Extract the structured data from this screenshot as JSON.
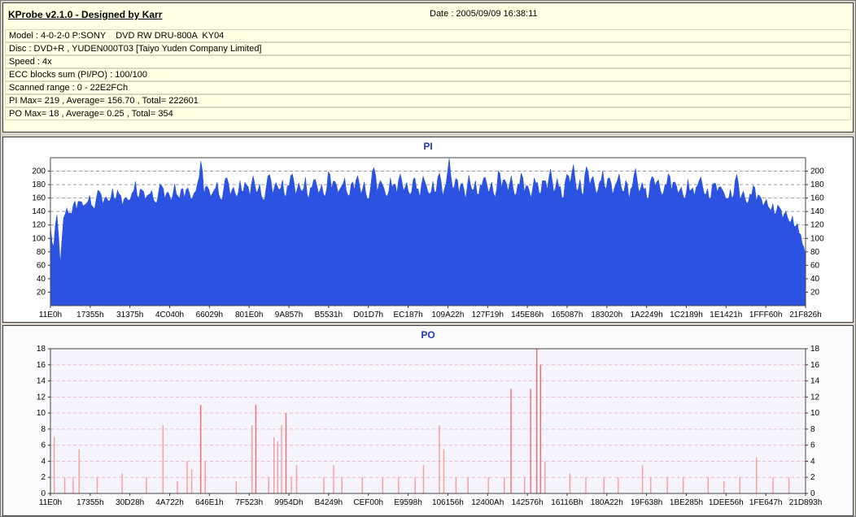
{
  "window": {
    "title": "KProbe v2.1.0 - Designed by Karr",
    "date_label": "Date : 2005/09/09 16:38:11"
  },
  "info": {
    "rows": [
      "Model : 4-0-2-0 P:SONY    DVD RW DRU-800A  KY04",
      "Disc : DVD+R , YUDEN000T03 [Taiyo Yuden Company Limited]",
      "Speed : 4x",
      "ECC blocks sum (PI/PO) : 100/100",
      "Scanned range : 0 - 22E2FCh",
      "PI Max= 219 , Average= 156.70 , Total= 222601",
      "PO Max= 18 , Average= 0.25 , Total= 354"
    ]
  },
  "chart_data": [
    {
      "id": "pi",
      "type": "bar",
      "title": "PI",
      "ylabel": "",
      "xlabel": "",
      "ylim": [
        0,
        220
      ],
      "yticks": [
        20,
        40,
        60,
        80,
        100,
        120,
        140,
        160,
        180,
        200
      ],
      "x_tick_labels": [
        "11E0h",
        "17355h",
        "31375h",
        "4C040h",
        "66029h",
        "801E0h",
        "9A857h",
        "B5531h",
        "D01D7h",
        "EC187h",
        "109A22h",
        "127F19h",
        "145E86h",
        "165087h",
        "183020h",
        "1A2249h",
        "1C2189h",
        "1E1421h",
        "1FFF60h",
        "21F826h"
      ],
      "bar_color": "#2C52E2",
      "grid_color": "#9898B0",
      "plot_bg": "#FFFFFF",
      "stats": {
        "max": 219,
        "average": 156.7,
        "total": 222601
      },
      "values": [
        118,
        88,
        135,
        62,
        130,
        145,
        138,
        150,
        143,
        155,
        148,
        152,
        164,
        147,
        158,
        170,
        151,
        162,
        155,
        174,
        159,
        166,
        149,
        161,
        156,
        168,
        185,
        160,
        172,
        158,
        165,
        171,
        154,
        166,
        178,
        159,
        169,
        156,
        181,
        163,
        173,
        160,
        175,
        158,
        168,
        182,
        215,
        166,
        177,
        162,
        171,
        184,
        159,
        173,
        190,
        164,
        176,
        161,
        186,
        170,
        179,
        163,
        193,
        168,
        181,
        158,
        175,
        195,
        166,
        183,
        172,
        187,
        161,
        178,
        196,
        165,
        182,
        170,
        191,
        159,
        176,
        188,
        167,
        180,
        162,
        199,
        173,
        185,
        168,
        177,
        190,
        164,
        181,
        172,
        193,
        166,
        184,
        158,
        178,
        205,
        169,
        186,
        175,
        162,
        190,
        180,
        167,
        196,
        171,
        183,
        165,
        188,
        174,
        161,
        192,
        178,
        166,
        185,
        170,
        197,
        163,
        181,
        219,
        176,
        189,
        167,
        182,
        158,
        194,
        172,
        186,
        165,
        179,
        191,
        168,
        184,
        161,
        200,
        175,
        187,
        170,
        193,
        164,
        181,
        197,
        169,
        178,
        160,
        190,
        183,
        167,
        186,
        172,
        203,
        168,
        189,
        177,
        161,
        195,
        182,
        210,
        170,
        188,
        164,
        207,
        179,
        192,
        166,
        184,
        201,
        173,
        190,
        165,
        181,
        196,
        170,
        186,
        158,
        177,
        204,
        169,
        183,
        175,
        161,
        192,
        178,
        187,
        164,
        180,
        196,
        171,
        184,
        167,
        176,
        158,
        188,
        172,
        163,
        179,
        191,
        166,
        174,
        160,
        182,
        169,
        177,
        168,
        159,
        173,
        164,
        195,
        157,
        170,
        152,
        166,
        178,
        155,
        163,
        148,
        158,
        144,
        152,
        138,
        146,
        130,
        140,
        125,
        133,
        118,
        108,
        92,
        75
      ]
    },
    {
      "id": "po",
      "type": "bar",
      "title": "PO",
      "ylabel": "",
      "xlabel": "",
      "ylim": [
        0,
        18
      ],
      "yticks": [
        0,
        2,
        4,
        6,
        8,
        10,
        12,
        14,
        16,
        18
      ],
      "x_tick_labels": [
        "11E0h",
        "17355h",
        "30D28h",
        "4A722h",
        "646E1h",
        "7F523h",
        "9954Dh",
        "B4249h",
        "CEF00h",
        "E9598h",
        "106156h",
        "12400Ah",
        "142576h",
        "16116Bh",
        "180A22h",
        "19F638h",
        "1BE285h",
        "1DEE56h",
        "1FE647h",
        "21D893h"
      ],
      "bar_color": "#F49C9C",
      "bar_color_strong": "#EE6A6A",
      "grid_color": "#EBB7C6",
      "plot_bg": "#F5F4FC",
      "stats": {
        "max": 18,
        "average": 0.25,
        "total": 354
      },
      "spikes": [
        {
          "x": 0.005,
          "v": 7
        },
        {
          "x": 0.019,
          "v": 2
        },
        {
          "x": 0.03,
          "v": 2
        },
        {
          "x": 0.038,
          "v": 5.5
        },
        {
          "x": 0.062,
          "v": 2
        },
        {
          "x": 0.095,
          "v": 2.5
        },
        {
          "x": 0.127,
          "v": 2
        },
        {
          "x": 0.149,
          "v": 8.5
        },
        {
          "x": 0.168,
          "v": 1.5
        },
        {
          "x": 0.181,
          "v": 4
        },
        {
          "x": 0.187,
          "v": 3
        },
        {
          "x": 0.199,
          "v": 11
        },
        {
          "x": 0.205,
          "v": 4
        },
        {
          "x": 0.246,
          "v": 1.5
        },
        {
          "x": 0.267,
          "v": 8.5
        },
        {
          "x": 0.272,
          "v": 11
        },
        {
          "x": 0.289,
          "v": 2
        },
        {
          "x": 0.296,
          "v": 7
        },
        {
          "x": 0.301,
          "v": 6.5
        },
        {
          "x": 0.306,
          "v": 8.5
        },
        {
          "x": 0.312,
          "v": 10
        },
        {
          "x": 0.319,
          "v": 2
        },
        {
          "x": 0.326,
          "v": 3.5
        },
        {
          "x": 0.362,
          "v": 2
        },
        {
          "x": 0.375,
          "v": 3.5
        },
        {
          "x": 0.386,
          "v": 2
        },
        {
          "x": 0.413,
          "v": 2
        },
        {
          "x": 0.44,
          "v": 2
        },
        {
          "x": 0.461,
          "v": 2
        },
        {
          "x": 0.483,
          "v": 2
        },
        {
          "x": 0.494,
          "v": 3.5
        },
        {
          "x": 0.515,
          "v": 8.5
        },
        {
          "x": 0.521,
          "v": 5.5
        },
        {
          "x": 0.537,
          "v": 2
        },
        {
          "x": 0.553,
          "v": 2
        },
        {
          "x": 0.58,
          "v": 2
        },
        {
          "x": 0.601,
          "v": 2
        },
        {
          "x": 0.61,
          "v": 13
        },
        {
          "x": 0.628,
          "v": 2
        },
        {
          "x": 0.636,
          "v": 13
        },
        {
          "x": 0.644,
          "v": 18
        },
        {
          "x": 0.649,
          "v": 16
        },
        {
          "x": 0.655,
          "v": 4
        },
        {
          "x": 0.688,
          "v": 2.5
        },
        {
          "x": 0.709,
          "v": 2
        },
        {
          "x": 0.733,
          "v": 2
        },
        {
          "x": 0.752,
          "v": 2
        },
        {
          "x": 0.784,
          "v": 3.5
        },
        {
          "x": 0.795,
          "v": 2
        },
        {
          "x": 0.817,
          "v": 2
        },
        {
          "x": 0.838,
          "v": 2
        },
        {
          "x": 0.871,
          "v": 2
        },
        {
          "x": 0.892,
          "v": 1.5
        },
        {
          "x": 0.913,
          "v": 2
        },
        {
          "x": 0.935,
          "v": 4.5
        },
        {
          "x": 0.957,
          "v": 2
        },
        {
          "x": 0.978,
          "v": 2
        }
      ]
    }
  ]
}
